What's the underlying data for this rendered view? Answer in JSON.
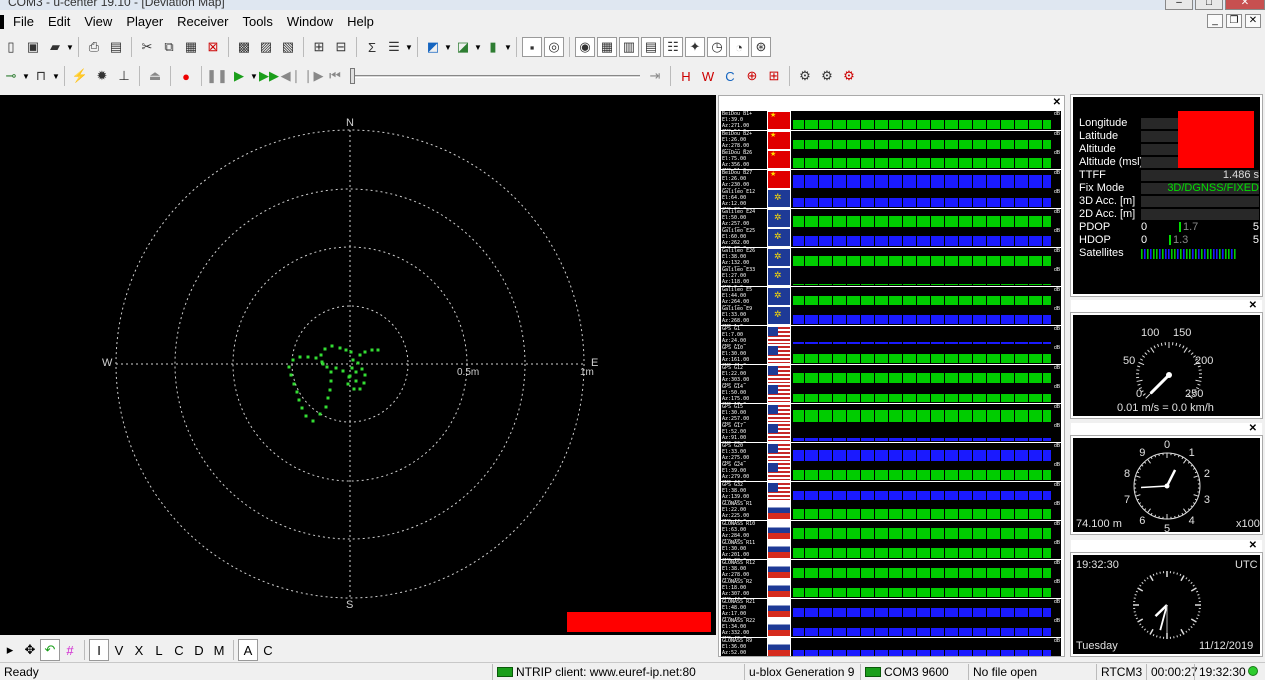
{
  "window": {
    "title": "COM3 - u-center 19.10 - [Deviation Map]"
  },
  "menu": [
    "File",
    "Edit",
    "View",
    "Player",
    "Receiver",
    "Tools",
    "Window",
    "Help"
  ],
  "deviation_map": {
    "compass": {
      "n": "N",
      "s": "S",
      "e": "E",
      "w": "W"
    },
    "scale_labels": [
      "0.5m",
      "1m"
    ]
  },
  "bottom_toolbar": {
    "letters": [
      "I",
      "V",
      "X",
      "L",
      "C",
      "D",
      "M",
      "A",
      "C"
    ]
  },
  "satellites": [
    {
      "flag": "cn",
      "name": "BeiDou B1+",
      "elev_az": "El:39.0 Az:271.00",
      "cn0": "CN0:54.0",
      "fill": "green",
      "level": 0.5
    },
    {
      "flag": "cn",
      "name": "BeiDou B2+",
      "elev_az": "El:26.00 Az:278.00",
      "cn0": "CN0:43.0",
      "fill": "green",
      "level": 0.55
    },
    {
      "flag": "cn",
      "name": "BeiDou B26",
      "elev_az": "El:75.00 Az:356.00",
      "cn0": "CN0:51.0",
      "fill": "green",
      "level": 0.6
    },
    {
      "flag": "cn",
      "name": "BeiDou B27",
      "elev_az": "El:26.00 Az:230.00",
      "cn0": "CN0:44.0",
      "fill": "blue",
      "level": 0.75
    },
    {
      "flag": "eu",
      "name": "Galileo E12",
      "elev_az": "El:64.00 Az:12.00",
      "cn0": "CN0:32.0",
      "fill": "blue",
      "level": 0.55
    },
    {
      "flag": "eu",
      "name": "Galileo E24",
      "elev_az": "El:50.00 Az:257.00",
      "cn0": "CN0:45.0",
      "fill": "green",
      "level": 0.65
    },
    {
      "flag": "eu",
      "name": "Galileo E25",
      "elev_az": "El:60.00 Az:262.00",
      "cn0": "CN0:39.0",
      "fill": "blue",
      "level": 0.6
    },
    {
      "flag": "eu",
      "name": "Galileo E26",
      "elev_az": "El:38.00 Az:132.00",
      "cn0": "CN0:39.0",
      "fill": "green",
      "level": 0.6
    },
    {
      "flag": "eu",
      "name": "Galileo E33",
      "elev_az": "El:27.00 Az:118.00",
      "cn0": "CN0:0.0",
      "fill": "green",
      "level": 0.05
    },
    {
      "flag": "eu",
      "name": "Galileo E5",
      "elev_az": "El:44.00 Az:264.00",
      "cn0": "CN0:46.0",
      "fill": "green",
      "level": 0.55
    },
    {
      "flag": "eu",
      "name": "Galileo E9",
      "elev_az": "El:33.00 Az:268.00",
      "cn0": "CN0:1.0",
      "fill": "blue",
      "level": 0.5
    },
    {
      "flag": "us",
      "name": "GPS G1",
      "elev_az": "El:7.00 Az:24.00",
      "cn0": "CN0:18.0",
      "fill": "blue",
      "level": 0.1
    },
    {
      "flag": "us",
      "name": "GPS G10",
      "elev_az": "El:30.00 Az:161.00",
      "cn0": "CN0:41.0",
      "fill": "green",
      "level": 0.55
    },
    {
      "flag": "us",
      "name": "GPS G12",
      "elev_az": "El:22.00 Az:303.00",
      "cn0": "CN0:39.0",
      "fill": "green",
      "level": 0.6
    },
    {
      "flag": "us",
      "name": "GPS G14",
      "elev_az": "El:50.00 Az:175.00",
      "cn0": "CN0:17.0",
      "fill": "green",
      "level": 0.45
    },
    {
      "flag": "us",
      "name": "GPS G15",
      "elev_az": "El:30.00 Az:257.00",
      "cn0": "CN0:42.0",
      "fill": "green",
      "level": 0.7
    },
    {
      "flag": "us",
      "name": "GPS G17",
      "elev_az": "El:52.00 Az:91.00",
      "cn0": "CN0:20.0",
      "fill": "blue",
      "level": 0.15
    },
    {
      "flag": "us",
      "name": "GPS G20",
      "elev_az": "El:33.00 Az:275.00",
      "cn0": "CN0:42.0",
      "fill": "blue",
      "level": 0.65
    },
    {
      "flag": "us",
      "name": "GPS G24",
      "elev_az": "El:39.00 Az:279.00",
      "cn0": "CN0:44.0",
      "fill": "green",
      "level": 0.6
    },
    {
      "flag": "us",
      "name": "GPS G32",
      "elev_az": "El:38.00 Az:139.00",
      "cn0": "CN0:39.0",
      "fill": "blue",
      "level": 0.55
    },
    {
      "flag": "ru",
      "name": "GLONASS R1",
      "elev_az": "El:22.00 Az:225.00",
      "cn0": "CN0:44.0",
      "fill": "green",
      "level": 0.6
    },
    {
      "flag": "ru",
      "name": "GLONASS R10",
      "elev_az": "El:63.00 Az:284.00",
      "cn0": "CN0:37.0",
      "fill": "green",
      "level": 0.65
    },
    {
      "flag": "ru",
      "name": "GLONASS R11",
      "elev_az": "El:30.00 Az:201.00",
      "cn0": "CN0:38.0",
      "fill": "green",
      "level": 0.6
    },
    {
      "flag": "ru",
      "name": "GLONASS R12",
      "elev_az": "El:38.00 Az:278.00",
      "cn0": "CN0:38.0",
      "fill": "green",
      "level": 0.6
    },
    {
      "flag": "ru",
      "name": "GLONASS R2",
      "elev_az": "El:18.00 Az:307.00",
      "cn0": "CN0:44.0",
      "fill": "green",
      "level": 0.55
    },
    {
      "flag": "ru",
      "name": "GLONASS R21",
      "elev_az": "El:48.00 Az:17.00",
      "cn0": "CN0:43.0",
      "fill": "blue",
      "level": 0.5
    },
    {
      "flag": "ru",
      "name": "GLONASS R22",
      "elev_az": "El:34.00 Az:332.00",
      "cn0": "CN0:40.0",
      "fill": "blue",
      "level": 0.45
    },
    {
      "flag": "ru",
      "name": "GLONASS R9",
      "elev_az": "El:36.00 Az:52.00",
      "cn0": "CN0:30.0",
      "fill": "blue",
      "level": 0.35
    }
  ],
  "info": {
    "longitude_label": "Longitude",
    "latitude_label": "Latitude",
    "altitude_label": "Altitude",
    "altitude_msl_label": "Altitude (msl)",
    "ttff_label": "TTFF",
    "ttff_value": "1.486 s",
    "fixmode_label": "Fix Mode",
    "fixmode_value": "3D/DGNSS/FIXED",
    "acc3d_label": "3D Acc. [m]",
    "acc2d_label": "2D Acc. [m]",
    "pdop_label": "PDOP",
    "pdop_min": "0",
    "pdop_max": "5",
    "pdop_value": "1.7",
    "hdop_label": "HDOP",
    "hdop_min": "0",
    "hdop_max": "5",
    "hdop_value": "1.3",
    "satellites_label": "Satellites"
  },
  "speedometer": {
    "ticks": [
      "0",
      "50",
      "100",
      "150",
      "200",
      "250"
    ],
    "readout": "0.01 m/s = 0.0 km/h",
    "speed": 0.01
  },
  "altimeter": {
    "ticks": [
      "0",
      "1",
      "2",
      "3",
      "4",
      "5",
      "6",
      "7",
      "8",
      "9"
    ],
    "altitude": "74.100 m",
    "multiplier": "x100"
  },
  "clock": {
    "time": "19:32:30",
    "zone": "UTC",
    "day": "Tuesday",
    "date": "11/12/2019"
  },
  "statusbar": {
    "ready": "Ready",
    "ntrip": "NTRIP client: www.euref-ip.net:80",
    "receiver": "u-blox Generation 9",
    "port": "COM3 9600",
    "file": "No file open",
    "protocol": "RTCM3",
    "elapsed": "00:00:27",
    "time": "19:32:30"
  },
  "colors": {
    "green_signal": "#00cc00",
    "blue_signal": "#1a1aff",
    "track": "#33dd33",
    "red_fill": "#ff0000"
  }
}
